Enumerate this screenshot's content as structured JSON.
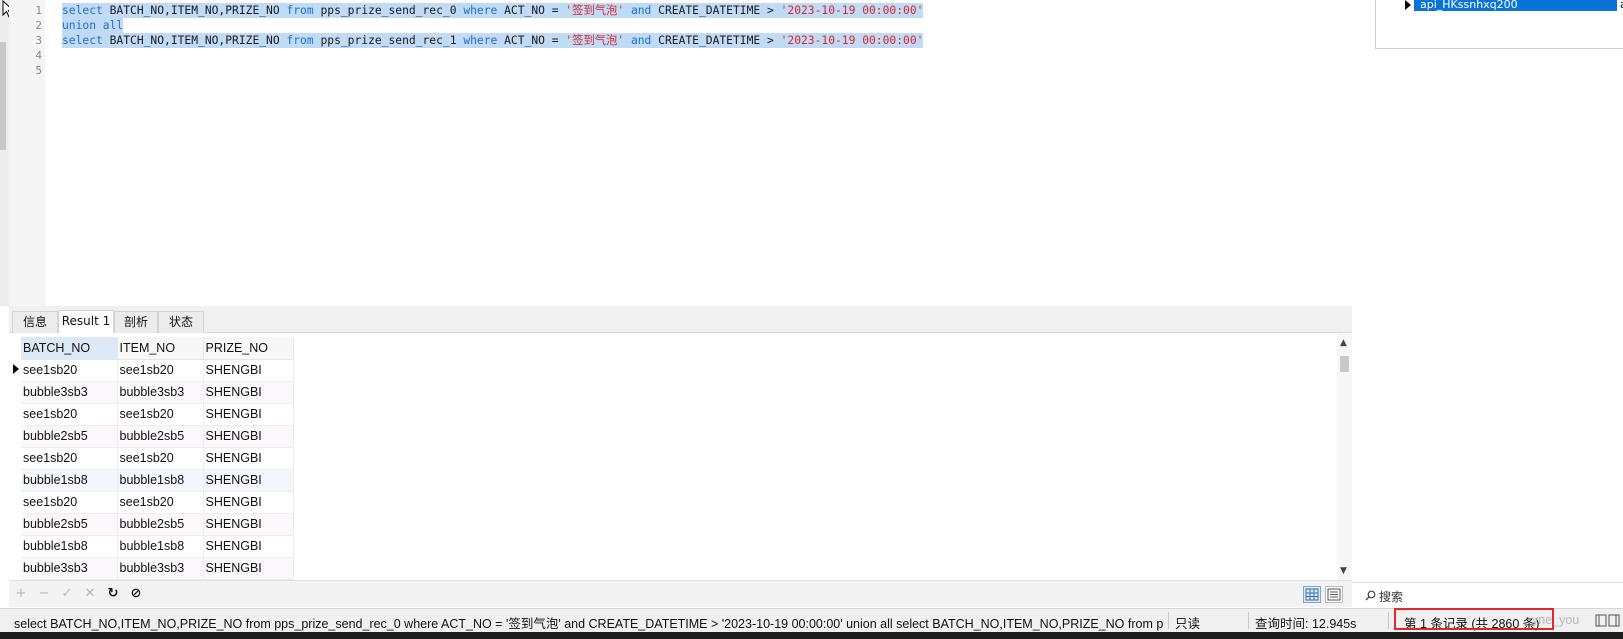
{
  "editor": {
    "line_numbers": [
      "1",
      "2",
      "3",
      "4",
      "5"
    ],
    "lines": [
      [
        {
          "t": "select",
          "k": "kw"
        },
        {
          "t": " BATCH_NO,ITEM_NO,PRIZE_NO ",
          "k": ""
        },
        {
          "t": "from",
          "k": "kw"
        },
        {
          "t": " pps_prize_send_rec_0 ",
          "k": ""
        },
        {
          "t": "where",
          "k": "kw"
        },
        {
          "t": " ACT_NO = ",
          "k": ""
        },
        {
          "t": "'签到气泡'",
          "k": "str"
        },
        {
          "t": " ",
          "k": ""
        },
        {
          "t": "and",
          "k": "kw"
        },
        {
          "t": " CREATE_DATETIME > ",
          "k": ""
        },
        {
          "t": "'2023-10-19 00:00:00'",
          "k": "str"
        }
      ],
      [
        {
          "t": "union all",
          "k": "kw"
        }
      ],
      [
        {
          "t": "select",
          "k": "kw"
        },
        {
          "t": " BATCH_NO,ITEM_NO,PRIZE_NO ",
          "k": ""
        },
        {
          "t": "from",
          "k": "kw"
        },
        {
          "t": " pps_prize_send_rec_1 ",
          "k": ""
        },
        {
          "t": "where",
          "k": "kw"
        },
        {
          "t": " ACT_NO = ",
          "k": ""
        },
        {
          "t": "'签到气泡'",
          "k": "str"
        },
        {
          "t": " ",
          "k": ""
        },
        {
          "t": "and",
          "k": "kw"
        },
        {
          "t": " CREATE_DATETIME > ",
          "k": ""
        },
        {
          "t": "'2023-10-19 00:00:00'",
          "k": "str"
        }
      ]
    ]
  },
  "right_panel": {
    "selected_item": "api_HKssnhxq200",
    "second_col": "api_r",
    "search_label": "搜索"
  },
  "tabs": [
    {
      "label": "信息",
      "active": false
    },
    {
      "label": "Result 1",
      "active": true
    },
    {
      "label": "剖析",
      "active": false
    },
    {
      "label": "状态",
      "active": false
    }
  ],
  "grid": {
    "columns": [
      "BATCH_NO",
      "ITEM_NO",
      "PRIZE_NO"
    ],
    "rows": [
      [
        "see1sb20",
        "see1sb20",
        "SHENGBI"
      ],
      [
        "bubble3sb3",
        "bubble3sb3",
        "SHENGBI"
      ],
      [
        "see1sb20",
        "see1sb20",
        "SHENGBI"
      ],
      [
        "bubble2sb5",
        "bubble2sb5",
        "SHENGBI"
      ],
      [
        "see1sb20",
        "see1sb20",
        "SHENGBI"
      ],
      [
        "bubble1sb8",
        "bubble1sb8",
        "SHENGBI"
      ],
      [
        "see1sb20",
        "see1sb20",
        "SHENGBI"
      ],
      [
        "bubble2sb5",
        "bubble2sb5",
        "SHENGBI"
      ],
      [
        "bubble1sb8",
        "bubble1sb8",
        "SHENGBI"
      ],
      [
        "bubble3sb3",
        "bubble3sb3",
        "SHENGBI"
      ]
    ]
  },
  "toolbar": {
    "add": "+",
    "remove": "−",
    "apply": "✓",
    "discard": "✕",
    "refresh": "↻",
    "stop": "⊘"
  },
  "status": {
    "sql": "select BATCH_NO,ITEM_NO,PRIZE_NO from pps_prize_send_rec_0 where ACT_NO = '签到气泡' and CREATE_DATETIME > '2023-10-19 00:00:00'  union all select BATCH_NO,ITEM_NO,PRIZE_NO from p",
    "readonly": "只读",
    "query_time": "查询时间: 12.945s",
    "record_info": "第 1 条记录 (共 2860 条)",
    "watermark": "yne_you"
  }
}
